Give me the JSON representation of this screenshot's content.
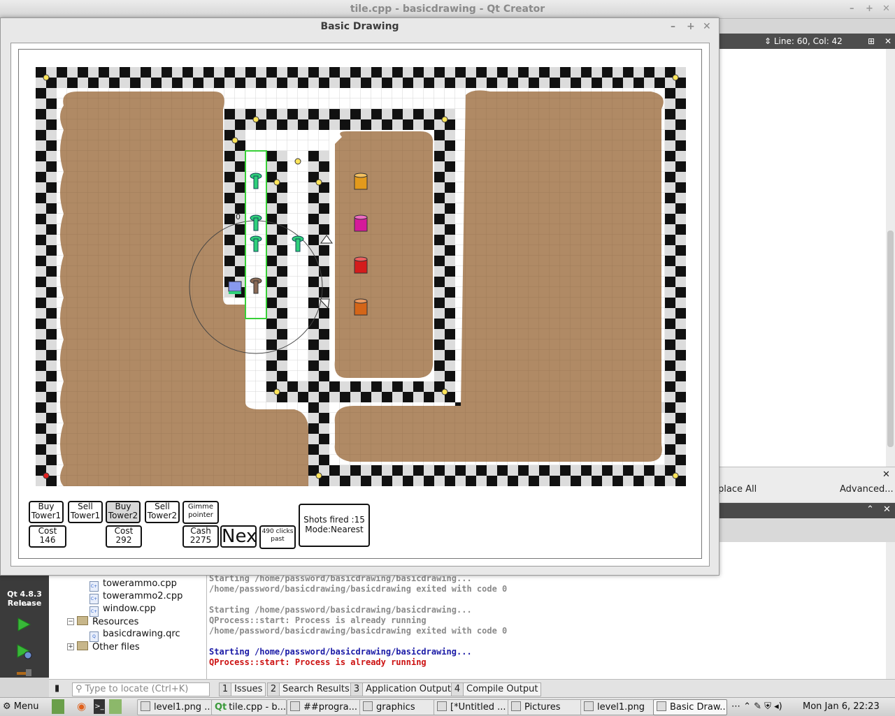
{
  "qt_window": {
    "title": "tile.cpp - basicdrawing - Qt Creator",
    "editor_position": "Line: 60, Col: 42",
    "replace_all_label": "place All",
    "advanced_label": "Advanced...",
    "kit_label": "Qt 4.8.3 i...",
    "build_mode": "Release"
  },
  "project_tree": {
    "items": [
      {
        "label": "towerammo.cpp",
        "kind": "file"
      },
      {
        "label": "towerammo2.cpp",
        "kind": "file"
      },
      {
        "label": "window.cpp",
        "kind": "file"
      },
      {
        "label": "Resources",
        "kind": "folder"
      },
      {
        "label": "basicdrawing.qrc",
        "kind": "file"
      },
      {
        "label": "Other files",
        "kind": "folder"
      }
    ]
  },
  "output": {
    "lines": [
      {
        "text": "Starting /home/password/basicdrawing/basicdrawing...",
        "color": "#8a8a8a"
      },
      {
        "text": "/home/password/basicdrawing/basicdrawing exited with code 0",
        "color": "#8a8a8a"
      },
      {
        "text": "",
        "color": "#8a8a8a"
      },
      {
        "text": "Starting /home/password/basicdrawing/basicdrawing...",
        "color": "#8a8a8a"
      },
      {
        "text": "QProcess::start: Process is already running",
        "color": "#8a8a8a"
      },
      {
        "text": "/home/password/basicdrawing/basicdrawing exited with code 0",
        "color": "#8a8a8a"
      },
      {
        "text": "",
        "color": "#8a8a8a"
      },
      {
        "text": "Starting /home/password/basicdrawing/basicdrawing...",
        "color": "#1a1aa6"
      },
      {
        "text": "QProcess::start: Process is already running",
        "color": "#cc1111"
      }
    ]
  },
  "status_bar": {
    "locate_placeholder": "Type to locate (Ctrl+K)",
    "tabs": [
      {
        "num": "1",
        "label": "Issues"
      },
      {
        "num": "2",
        "label": "Search Results"
      },
      {
        "num": "3",
        "label": "Application Output"
      },
      {
        "num": "4",
        "label": "Compile Output"
      }
    ]
  },
  "taskbar": {
    "menu_label": "Menu",
    "tasks": [
      {
        "label": "level1.png ..."
      },
      {
        "label": "tile.cpp - b..."
      },
      {
        "label": "##progra..."
      },
      {
        "label": "graphics"
      },
      {
        "label": "[*Untitled ..."
      },
      {
        "label": "Pictures"
      },
      {
        "label": "level1.png"
      },
      {
        "label": "Basic Draw..."
      }
    ],
    "clock": "Mon Jan  6, 22:23"
  },
  "dialog": {
    "title": "Basic Drawing",
    "buttons": {
      "buy_tower1": [
        "Buy",
        "Tower1"
      ],
      "sell_tower1": [
        "Sell",
        "Tower1"
      ],
      "buy_tower2": [
        "Buy",
        "Tower2"
      ],
      "sell_tower2": [
        "Sell",
        "Tower2"
      ],
      "gimme_pointer": [
        "Gimme",
        "pointer"
      ],
      "cost1": [
        "Cost",
        "146"
      ],
      "cost2": [
        "Cost",
        "292"
      ],
      "cash": [
        "Cash",
        "2275"
      ],
      "next": "Next",
      "clicks": [
        "490 clicks",
        "past"
      ]
    },
    "info": {
      "shots": "Shots fired :15",
      "mode": "Mode:Nearest"
    },
    "tower_label": "0",
    "colors": {
      "dirt": "#b08a65",
      "tower_green": "#2fd07a",
      "ammo_orange": "#e39a1c",
      "ammo_magenta": "#d51a9a",
      "ammo_red": "#d41c1c",
      "ammo_darkorange": "#d46518"
    }
  }
}
